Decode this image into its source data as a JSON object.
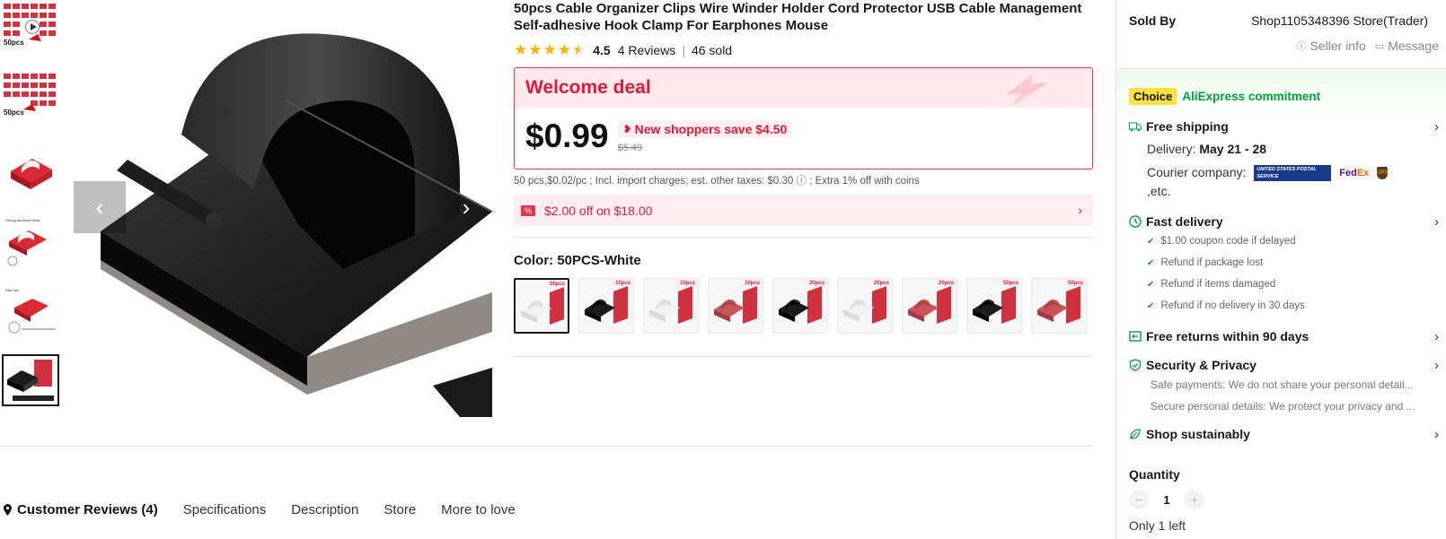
{
  "thumbnails": [
    {
      "badge": "50pcs",
      "video": true
    },
    {
      "badge": "50pcs",
      "video": false
    },
    {
      "badge": "",
      "video": false
    },
    {
      "badge": "",
      "video": false
    },
    {
      "badge": "",
      "video": false
    },
    {
      "badge": "",
      "video": false
    }
  ],
  "product": {
    "title": "50pcs Cable Organizer Clips Wire Winder Holder Cord Protector USB Cable Management Self-adhesive Hook Clamp For Earphones Mouse",
    "rating": "4.5",
    "rating_value": 4.5,
    "reviews": "4 Reviews",
    "sold": "46 sold"
  },
  "deal": {
    "title": "Welcome deal",
    "price": "$0.99",
    "save": "New shoppers save $4.50",
    "old_price": "$5.49",
    "tax_note": "50 pcs,$0.02/pc ; Incl. import charges; est. other taxes: $0.30 ⓘ ; Extra 1% off with coins",
    "coupon": "$2.00 off on $18.00"
  },
  "color": {
    "label": "Color: 50PCS-White",
    "swatches": [
      {
        "pcs": "50pcs",
        "tone": "white"
      },
      {
        "pcs": "10pcs",
        "tone": "black"
      },
      {
        "pcs": "10pcs",
        "tone": "white"
      },
      {
        "pcs": "10pcs",
        "tone": "red"
      },
      {
        "pcs": "20pcs",
        "tone": "black"
      },
      {
        "pcs": "20pcs",
        "tone": "white"
      },
      {
        "pcs": "20pcs",
        "tone": "red"
      },
      {
        "pcs": "50pcs",
        "tone": "black"
      },
      {
        "pcs": "50pcs",
        "tone": "red"
      }
    ]
  },
  "tabs": [
    "Customer Reviews (4)",
    "Specifications",
    "Description",
    "Store",
    "More to love"
  ],
  "seller": {
    "sold_by": "Sold By",
    "store": "Shop1105348396 Store(Trader)",
    "info": "Seller info",
    "message": "Message"
  },
  "commitment": {
    "choice": "Choice",
    "text": "AliExpress commitment"
  },
  "shipping": {
    "title": "Free shipping",
    "delivery_label": "Delivery:",
    "delivery_value": "May 21 - 28",
    "courier_label": "Courier company:",
    "etc": ",etc.",
    "usps": "UNITED STATES POSTAL SERVICE",
    "fedex_1": "Fed",
    "fedex_2": "Ex",
    "ups": "UPS"
  },
  "fast_delivery": {
    "title": "Fast delivery",
    "items": [
      "$1.00 coupon code if delayed",
      "Refund if package lost",
      "Refund if items damaged",
      "Refund if no delivery in 30 days"
    ]
  },
  "returns": {
    "title": "Free returns within 90 days"
  },
  "security": {
    "title": "Security & Privacy",
    "items": [
      "Safe payments: We do not share your personal detail...",
      "Secure personal details: We protect your privacy and ..."
    ]
  },
  "sustain": {
    "title": "Shop sustainably"
  },
  "quantity": {
    "label": "Quantity",
    "value": "1",
    "minus": "−",
    "plus": "+",
    "stock": "Only 1 left"
  },
  "colors": {
    "accent": "#e0193b",
    "green": "#00a33b",
    "choice_yellow": "#fde13c",
    "star": "#f7b500"
  }
}
